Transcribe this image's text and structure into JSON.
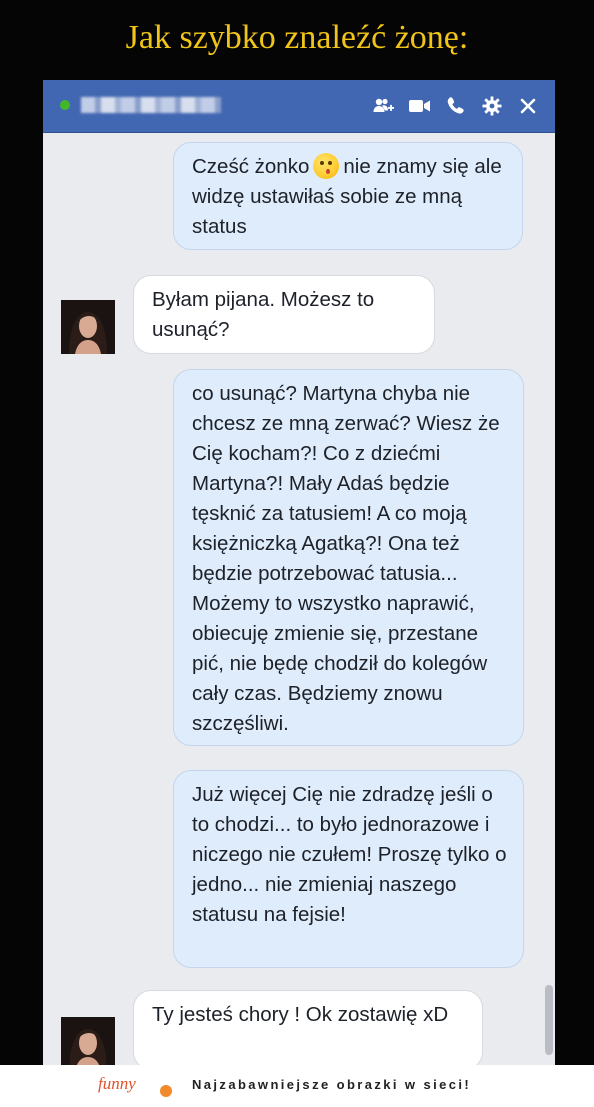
{
  "page": {
    "title": "Jak szybko znaleźć żonę:"
  },
  "header": {
    "contact_name": "",
    "icons": [
      "add-user-icon",
      "video-call-icon",
      "phone-icon",
      "gear-icon",
      "close-icon"
    ]
  },
  "messages": [
    {
      "sender": "me",
      "parts": [
        "Cześć żonko",
        "nie znamy się ale widzę ustawiłaś sobie ze mną status"
      ],
      "emoji": "kiss-emoji"
    },
    {
      "sender": "her",
      "text": "Byłam pijana. Możesz to usunąć?"
    },
    {
      "sender": "me",
      "text": "co usunąć? Martyna chyba nie chcesz ze mną zerwać? Wiesz że Cię kocham?! Co z dziećmi Martyna?! Mały Adaś będzie tęsknić za tatusiem! A co moją księżniczką Agatką?! Ona też będzie potrzebować tatusia... Możemy to wszystko naprawić, obiecuję zmienie się, przestane pić, nie będę chodził do kolegów cały czas. Będziemy znowu szczęśliwi."
    },
    {
      "sender": "me",
      "text": "Już więcej Cię nie zdradzę jeśli o to chodzi... to było jednorazowe i niczego nie czułem! Proszę tylko o jedno... nie zmieniaj naszego statusu na fejsie!"
    },
    {
      "sender": "her",
      "text": "Ty jesteś chory ! Ok zostawię xD"
    }
  ],
  "footer": {
    "logo": "funny",
    "tagline": "Najzabawniejsze obrazki w sieci!"
  },
  "colors": {
    "title": "#f0c419",
    "header_bar": "#4267b2",
    "online": "#42b72a",
    "outgoing_bubble": "#dfecfb",
    "incoming_bubble": "#ffffff",
    "chat_background": "#e9ebee"
  }
}
